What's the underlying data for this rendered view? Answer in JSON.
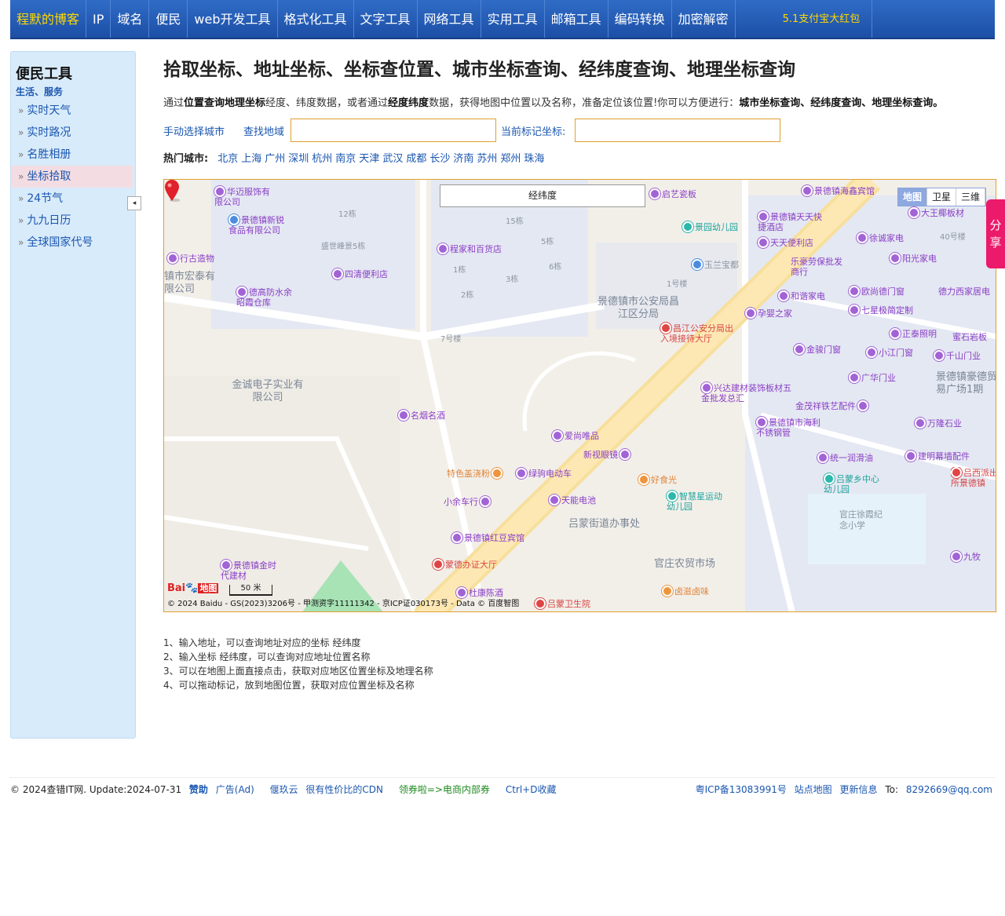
{
  "nav": {
    "brand": "程默的博客",
    "items": [
      "IP",
      "域名",
      "便民",
      "web开发工具",
      "格式化工具",
      "文字工具",
      "网络工具",
      "实用工具",
      "邮箱工具",
      "编码转换",
      "加密解密"
    ],
    "promo": "5.1支付宝大红包"
  },
  "sidebar": {
    "title": "便民工具",
    "subtitle": "生活、服务",
    "items": [
      "实时天气",
      "实时路况",
      "名胜相册",
      "坐标拾取",
      "24节气",
      "九九日历",
      "全球国家代号"
    ],
    "active_index": 3,
    "collapse_icon": "◂"
  },
  "main": {
    "title": "拾取坐标、地址坐标、坐标查位置、城市坐标查询、经纬度查询、地理坐标查询",
    "intro": {
      "p1": "通过",
      "b1": "位置查询地理坐标",
      "p2": "经度、纬度数据，或者通过",
      "b2": "经度纬度",
      "p3": "数据，获得地图中位置以及名称，准备定位该位置!你可以方便进行：",
      "b3": "城市坐标查询、经纬度查询、地理坐标查询。"
    },
    "search": {
      "choose_city": "手动选择城市",
      "find_area": "查找地域",
      "find_value": "",
      "current_mark": "当前标记坐标:",
      "current_value": ""
    },
    "hot": {
      "label": "热门城市:",
      "cities": [
        "北京",
        "上海",
        "广州",
        "深圳",
        "杭州",
        "南京",
        "天津",
        "武汉",
        "成都",
        "长沙",
        "济南",
        "苏州",
        "郑州",
        "珠海"
      ]
    },
    "map": {
      "coord_label": "经纬度",
      "types": [
        "地图",
        "卫星",
        "三维"
      ],
      "active_type": "地图",
      "scale": "50 米",
      "copyright": "© 2024 Baidu - GS(2023)3206号 - 甲测资字11111342 - 京ICP证030173号 - Data © 百度智图",
      "logo": "Bai",
      "logo2": "地图",
      "pois": [
        {
          "t": "华迈服饰有限公司",
          "c": ""
        },
        {
          "t": "景德镇新锐食品有限公司",
          "c": ""
        },
        {
          "t": "行古造物",
          "c": ""
        },
        {
          "t": "德高防水余昭霞仓库",
          "c": ""
        },
        {
          "t": "四清便利店",
          "c": ""
        },
        {
          "t": "程家和百货店",
          "c": ""
        },
        {
          "t": "启艺瓷板",
          "c": ""
        },
        {
          "t": "景园幼儿园",
          "c": "green"
        },
        {
          "t": "玉兰宝都",
          "c": "grey"
        },
        {
          "t": "景德镇海鑫宾馆",
          "c": ""
        },
        {
          "t": "景德镇天天快捷酒店",
          "c": ""
        },
        {
          "t": "天天便利店",
          "c": ""
        },
        {
          "t": "大王椰板材",
          "c": ""
        },
        {
          "t": "徐诚家电",
          "c": ""
        },
        {
          "t": "阳光家电",
          "c": ""
        },
        {
          "t": "乐豪劳保批发商行",
          "c": ""
        },
        {
          "t": "和谐家电",
          "c": ""
        },
        {
          "t": "欧尚德门窗",
          "c": ""
        },
        {
          "t": "德力西家居电",
          "c": ""
        },
        {
          "t": "孕婴之家",
          "c": ""
        },
        {
          "t": "七星极简定制",
          "c": ""
        },
        {
          "t": "昌江公安分局出入境接待大厅",
          "c": "red"
        },
        {
          "t": "正泰照明",
          "c": ""
        },
        {
          "t": "蜜石岩板",
          "c": ""
        },
        {
          "t": "金骏门窗",
          "c": ""
        },
        {
          "t": "小江门窗",
          "c": ""
        },
        {
          "t": "千山门业",
          "c": ""
        },
        {
          "t": "广华门业",
          "c": ""
        },
        {
          "t": "兴达建材装饰板材五金批发总汇",
          "c": ""
        },
        {
          "t": "金茂祥铁艺配件",
          "c": ""
        },
        {
          "t": "名烟名酒",
          "c": ""
        },
        {
          "t": "景德镇市海利不锈钢管",
          "c": ""
        },
        {
          "t": "万隆石业",
          "c": ""
        },
        {
          "t": "爱尚唯品",
          "c": ""
        },
        {
          "t": "新视眼镜",
          "c": ""
        },
        {
          "t": "统一润滑油",
          "c": ""
        },
        {
          "t": "建明幕墙配件",
          "c": ""
        },
        {
          "t": "特色盖浇粉",
          "c": "orange"
        },
        {
          "t": "绿驹电动车",
          "c": ""
        },
        {
          "t": "好食光",
          "c": "orange"
        },
        {
          "t": "吕蒙乡中心幼儿园",
          "c": "green"
        },
        {
          "t": "吕西派出所景德镇",
          "c": "red"
        },
        {
          "t": "小余车行",
          "c": ""
        },
        {
          "t": "天能电池",
          "c": ""
        },
        {
          "t": "智慧星运动幼儿园",
          "c": "green"
        },
        {
          "t": "景德镇红豆宾馆",
          "c": ""
        },
        {
          "t": "九牧",
          "c": ""
        },
        {
          "t": "景德镇金时代建材",
          "c": ""
        },
        {
          "t": "蒙德办证大厅",
          "c": "red"
        },
        {
          "t": "杜康陈酒",
          "c": ""
        },
        {
          "t": "卤滋卤味",
          "c": "orange"
        },
        {
          "t": "吕蒙卫生院",
          "c": "red"
        }
      ],
      "areas": [
        {
          "t": "景德镇市公安局昌江区分局"
        },
        {
          "t": "金诚电子实业有限公司"
        },
        {
          "t": "吕蒙街道办事处"
        },
        {
          "t": "官庄农贸市场"
        },
        {
          "t": "景德镇豪德贸易广场1期"
        },
        {
          "t": "镇市宏泰有限公司"
        },
        {
          "t": "官庄徐霞纪念小学"
        }
      ],
      "buildings": [
        "12栋",
        "盛世峰景5栋",
        "15栋",
        "5栋",
        "1栋",
        "3栋",
        "6栋",
        "2栋",
        "1号楼",
        "7号楼",
        "40号楼"
      ]
    },
    "notes": [
      "1、输入地址，可以查询地址对应的坐标 经纬度",
      "2、输入坐标 经纬度，可以查询对应地址位置名称",
      "3、可以在地图上面直接点击，获取对应地区位置坐标及地理名称",
      "4、可以拖动标记，放到地图位置，获取对应位置坐标及名称"
    ]
  },
  "share": {
    "line1": "分",
    "line2": "享"
  },
  "footer": {
    "copyright": "© 2024查错IT网. Update:2024-07-31",
    "sponsor": "赞助",
    "ad": "广告(Ad)",
    "cdn1": "偃玖云",
    "cdn2": "很有性价比的CDN",
    "coupon": "领券啦=>电商内部券",
    "fav": "Ctrl+D收藏",
    "icp": "粤ICP备13083991号",
    "sitemap": "站点地图",
    "updates": "更新信息",
    "to": "To:",
    "email": "8292669@qq.com"
  }
}
